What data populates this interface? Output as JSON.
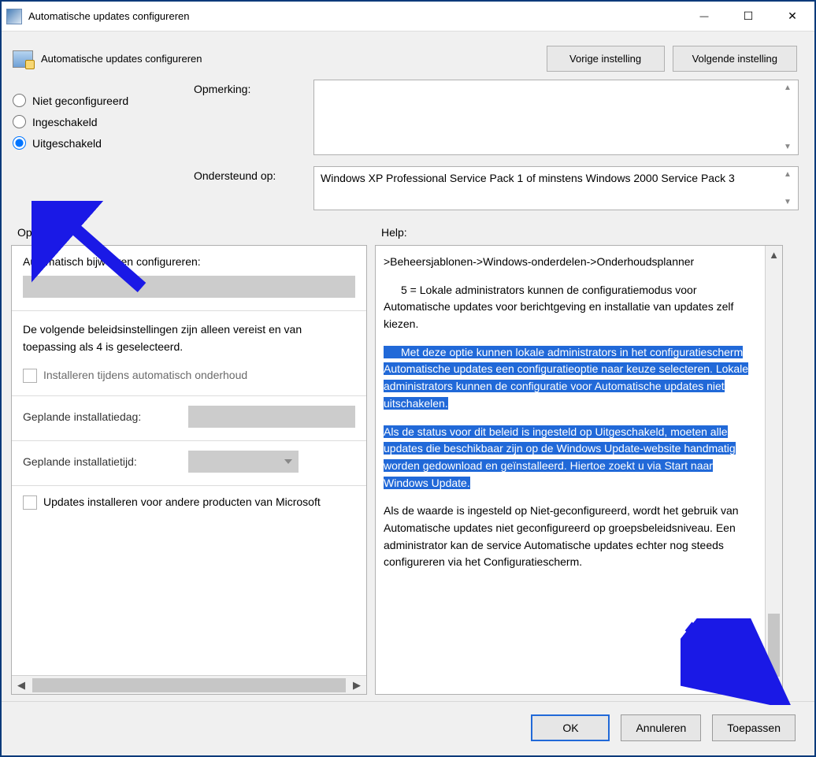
{
  "window": {
    "title": "Automatische updates configureren"
  },
  "header": {
    "policy_title": "Automatische updates configureren",
    "prev_button": "Vorige instelling",
    "next_button": "Volgende instelling"
  },
  "radio": {
    "not_configured": "Niet geconfigureerd",
    "enabled": "Ingeschakeld",
    "disabled": "Uitgeschakeld",
    "selected": "disabled"
  },
  "comment": {
    "label": "Opmerking:",
    "value": ""
  },
  "supported": {
    "label": "Ondersteund op:",
    "value": "Windows XP Professional Service Pack 1 of minstens Windows 2000 Service Pack 3"
  },
  "sections": {
    "options_label": "Opties:",
    "help_label": "Help:"
  },
  "options": {
    "configure_label": "Automatisch bijwerken configureren:",
    "note": "De volgende beleidsinstellingen zijn alleen vereist en van toepassing als 4 is geselecteerd.",
    "install_during_maint": "Installeren tijdens automatisch onderhoud",
    "scheduled_day_label": "Geplande installatiedag:",
    "scheduled_time_label": "Geplande installatietijd:",
    "other_products": "Updates installeren voor andere producten van Microsoft"
  },
  "help": {
    "breadcrumb": ">Beheersjablonen->Windows-onderdelen->Onderhoudsplanner",
    "para1": "5 = Lokale administrators kunnen de configuratiemodus voor Automatische updates voor berichtgeving en installatie van updates zelf kiezen.",
    "para2": "Met deze optie kunnen lokale administrators in het configuratiescherm Automatische updates een configuratieoptie naar keuze selecteren. Lokale administrators kunnen de configuratie voor Automatische updates niet uitschakelen.",
    "para3": "Als de status voor dit beleid is ingesteld op Uitgeschakeld, moeten alle updates die beschikbaar zijn op de Windows Update-website handmatig worden gedownload en geïnstalleerd. Hiertoe zoekt u via Start naar Windows Update.",
    "para4": "Als de waarde is ingesteld op Niet-geconfigureerd, wordt het gebruik van Automatische updates niet geconfigureerd op groepsbeleidsniveau. Een administrator kan de service Automatische updates echter nog steeds configureren via het Configuratiescherm."
  },
  "footer": {
    "ok": "OK",
    "cancel": "Annuleren",
    "apply": "Toepassen"
  },
  "annotation": {
    "arrow_color": "#1a19e6"
  }
}
